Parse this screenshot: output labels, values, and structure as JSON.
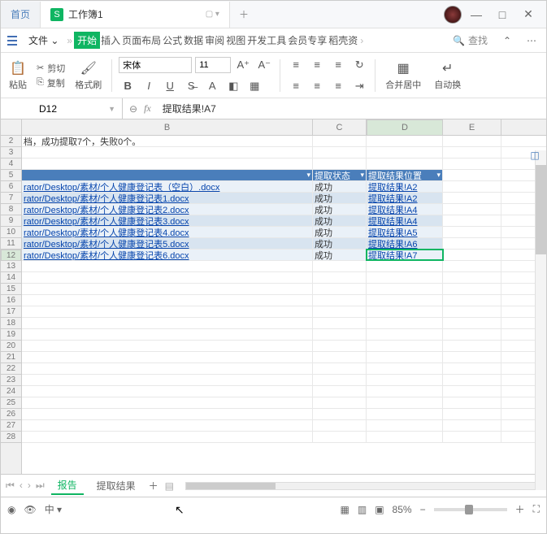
{
  "titlebar": {
    "home": "首页",
    "workbook": "工作簿1"
  },
  "menubar": {
    "file": "文件",
    "tabs": [
      "开始",
      "插入",
      "页面布局",
      "公式",
      "数据",
      "审阅",
      "视图",
      "开发工具",
      "会员专享",
      "稻壳资"
    ],
    "search": "查找"
  },
  "ribbon": {
    "cut": "剪切",
    "paste": "粘贴",
    "copy": "复制",
    "format_painter": "格式刷",
    "font": "宋体",
    "size": "11",
    "merge": "合并居中",
    "autowrap": "自动换"
  },
  "namebox": "D12",
  "formula": "提取结果!A7",
  "cols": [
    "B",
    "C",
    "D",
    "E"
  ],
  "row2": "档，成功提取7个，失败0个。",
  "header_row": {
    "c": "提取状态",
    "d": "提取结果位置"
  },
  "rows": [
    {
      "n": 6,
      "b": "rator/Desktop/素材/个人健康登记表（空白）.docx",
      "c": "成功",
      "d": "提取结果!A2"
    },
    {
      "n": 7,
      "b": "rator/Desktop/素材/个人健康登记表1.docx",
      "c": "成功",
      "d": "提取结果!A2"
    },
    {
      "n": 8,
      "b": "rator/Desktop/素材/个人健康登记表2.docx",
      "c": "成功",
      "d": "提取结果!A4"
    },
    {
      "n": 9,
      "b": "rator/Desktop/素材/个人健康登记表3.docx",
      "c": "成功",
      "d": "提取结果!A4"
    },
    {
      "n": 10,
      "b": "rator/Desktop/素材/个人健康登记表4.docx",
      "c": "成功",
      "d": "提取结果!A5"
    },
    {
      "n": 11,
      "b": "rator/Desktop/素材/个人健康登记表5.docx",
      "c": "成功",
      "d": "提取结果!A6"
    },
    {
      "n": 12,
      "b": "rator/Desktop/素材/个人健康登记表6.docx",
      "c": "成功",
      "d": "提取结果!A7"
    }
  ],
  "sheets": {
    "report": "报告",
    "result": "提取结果"
  },
  "status": {
    "zoom": "85%"
  }
}
